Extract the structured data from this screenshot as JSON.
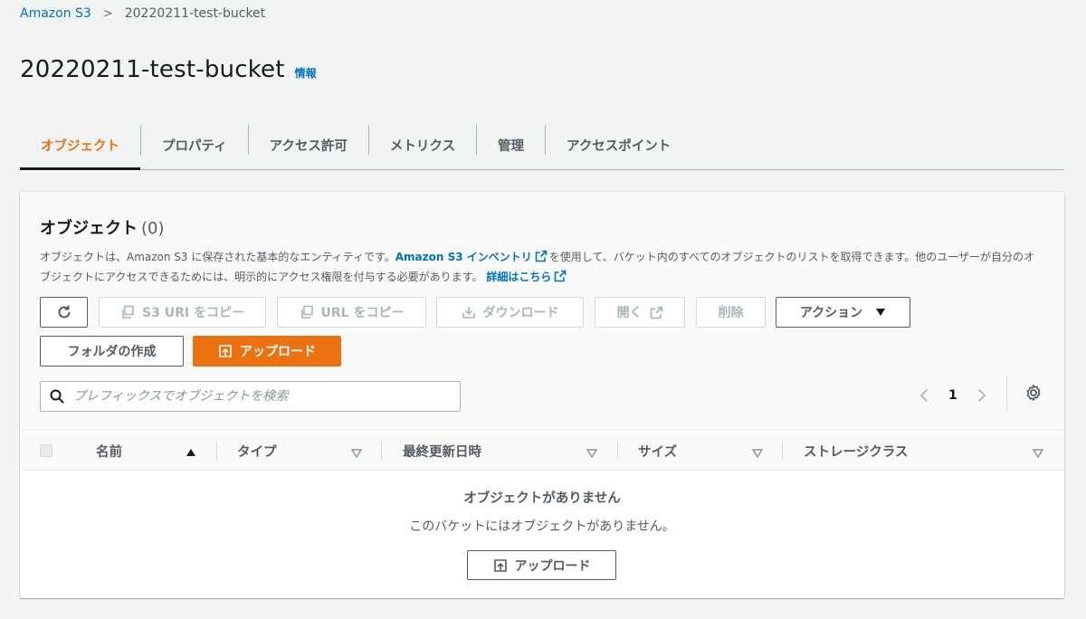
{
  "breadcrumb": {
    "root": "Amazon S3",
    "separator": ">",
    "current": "20220211-test-bucket"
  },
  "header": {
    "title": "20220211-test-bucket",
    "info": "情報"
  },
  "tabs": [
    {
      "label": "オブジェクト",
      "active": true
    },
    {
      "label": "プロパティ",
      "active": false
    },
    {
      "label": "アクセス許可",
      "active": false
    },
    {
      "label": "メトリクス",
      "active": false
    },
    {
      "label": "管理",
      "active": false
    },
    {
      "label": "アクセスポイント",
      "active": false
    }
  ],
  "objects": {
    "title": "オブジェクト",
    "count": "(0)",
    "description": {
      "part1": "オブジェクトは、Amazon S3 に保存された基本的なエンティティです。",
      "inventory_link": "Amazon S3 インベントリ",
      "part2": "を使用して、バケット内のすべてのオブジェクトのリストを取得できます。他のユーザーが自分のオブジェクトにアクセスできるためには、明示的にアクセス権限を付与する必要があります。",
      "details_link": "詳細はこちら"
    },
    "toolbar": {
      "copy_s3_uri": "S3 URI をコピー",
      "copy_url": "URL をコピー",
      "download": "ダウンロード",
      "open": "開く",
      "delete": "削除",
      "actions": "アクション",
      "create_folder": "フォルダの作成",
      "upload": "アップロード"
    },
    "search": {
      "placeholder": "プレフィックスでオブジェクトを検索"
    },
    "pagination": {
      "current_page": "1"
    },
    "columns": [
      "名前",
      "タイプ",
      "最終更新日時",
      "サイズ",
      "ストレージクラス"
    ],
    "empty": {
      "title": "オブジェクトがありません",
      "message": "このバケットにはオブジェクトがありません。",
      "upload": "アップロード"
    }
  },
  "colors": {
    "accent": "#ec7211",
    "link": "#0073bb",
    "text": "#16191f",
    "muted": "#545b64"
  }
}
